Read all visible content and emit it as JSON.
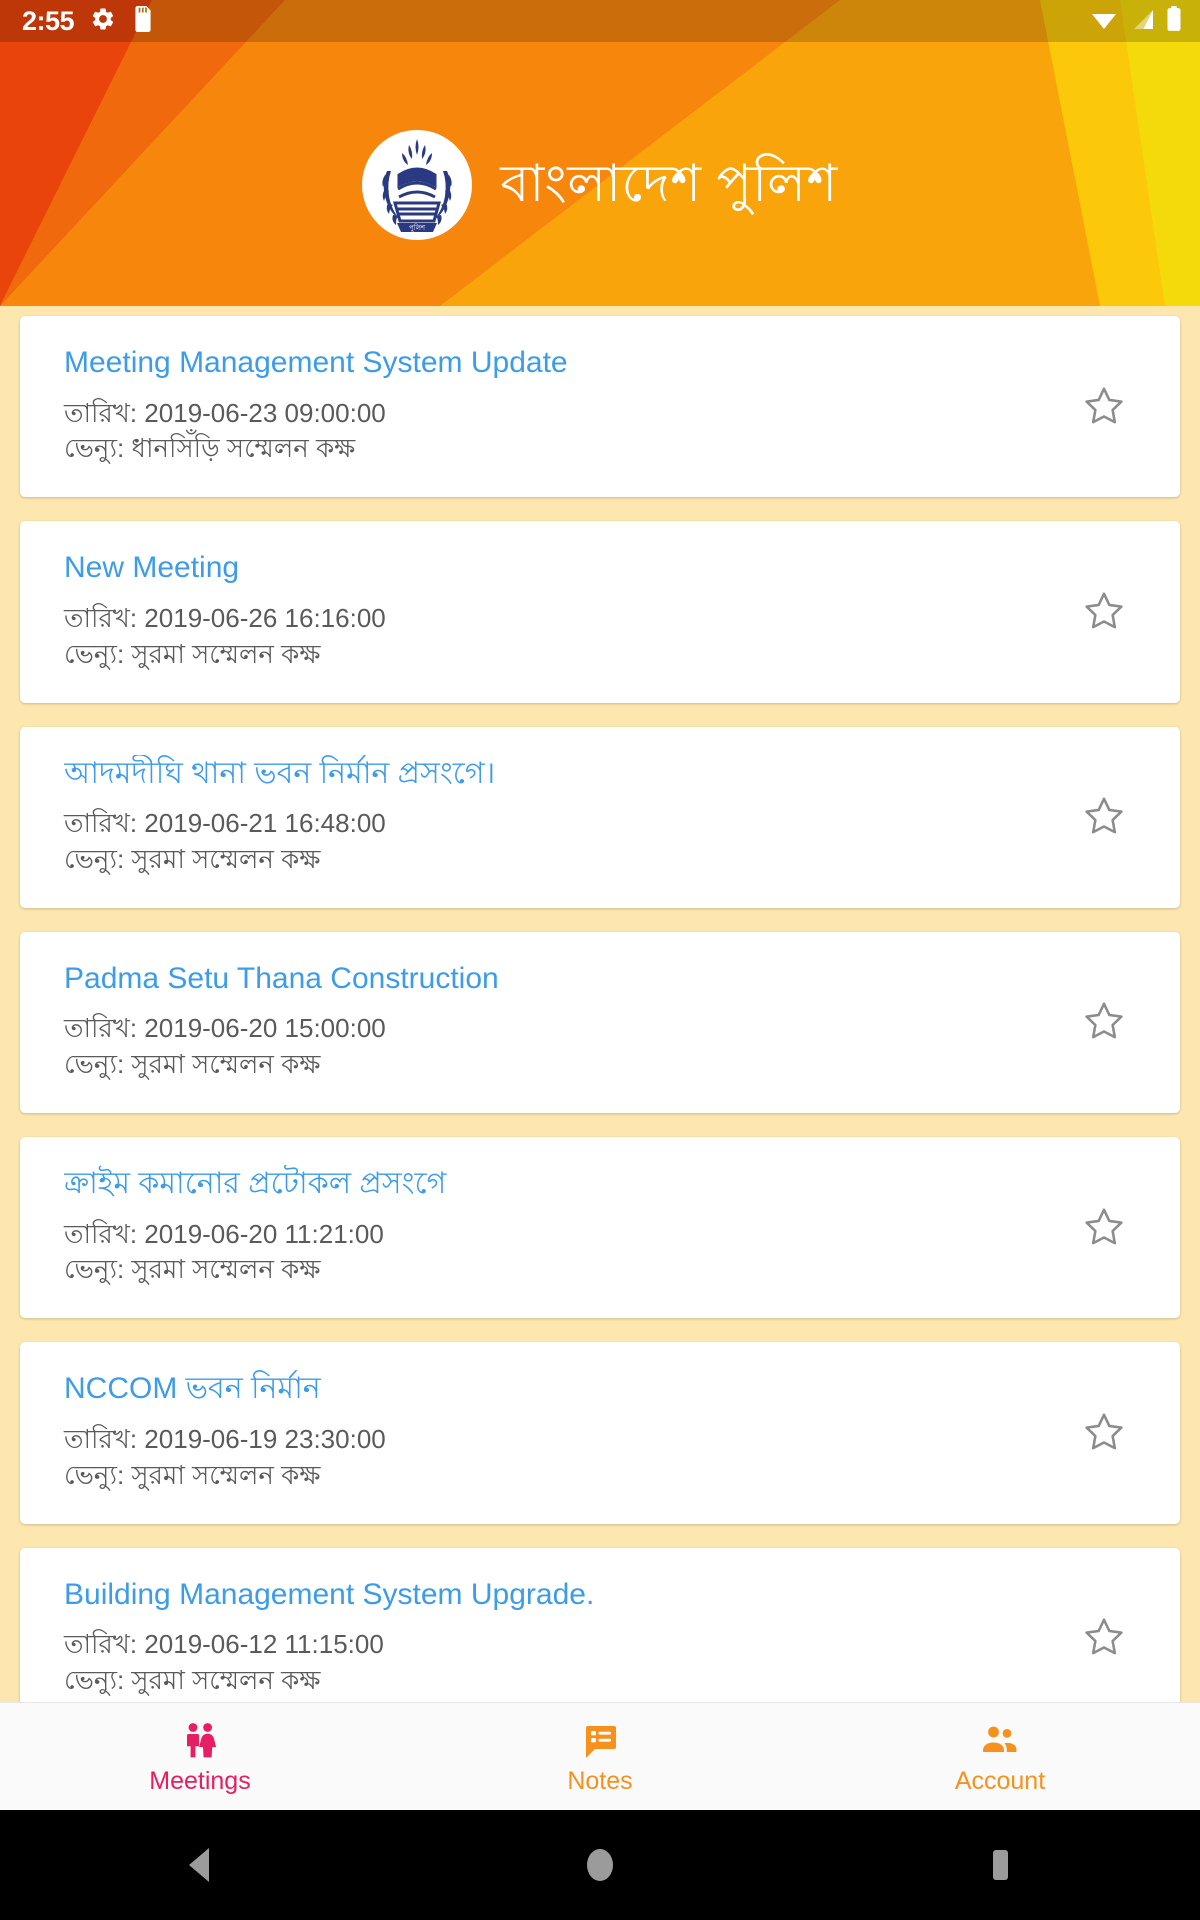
{
  "status_bar": {
    "time": "2:55",
    "icons": [
      "gear-icon",
      "sd-card-icon",
      "wifi-icon",
      "cellular-signal-icon",
      "battery-icon"
    ]
  },
  "header": {
    "title": "বাংলাদেশ পুলিশ",
    "logo_name": "bangladesh-police-emblem",
    "colors": {
      "red": "#E8440C",
      "orange": "#F7860D",
      "orange_light": "#F99A12",
      "amber": "#FBB40A",
      "yellow": "#F5DA0B",
      "status_tint": "#B5700A"
    }
  },
  "theme": {
    "page_background": "#FDE7AF",
    "card_background": "#FFFFFF",
    "title_color": "#3D9CE8",
    "meta_color": "#5A5A5A",
    "star_color": "#8C8C8C",
    "active_nav_color": "#E61E63",
    "inactive_nav_color": "#F5921E"
  },
  "labels": {
    "date_prefix": "তারিখ:",
    "venue_prefix": "ভেন্যু:"
  },
  "meetings": [
    {
      "title": "Meeting Management System Update",
      "date": "তারিখ: 2019-06-23 09:00:00",
      "venue": "ভেন্যু: ধানসিঁড়ি সম্মেলন কক্ষ",
      "starred": false
    },
    {
      "title": "New Meeting",
      "date": "তারিখ: 2019-06-26 16:16:00",
      "venue": "ভেন্যু: সুরমা সম্মেলন কক্ষ",
      "starred": false
    },
    {
      "title": "আদমদীঘি থানা ভবন নির্মান প্রসংগে।",
      "date": "তারিখ: 2019-06-21 16:48:00",
      "venue": "ভেন্যু: সুরমা সম্মেলন কক্ষ",
      "starred": false
    },
    {
      "title": "Padma Setu Thana Construction",
      "date": "তারিখ: 2019-06-20 15:00:00",
      "venue": "ভেন্যু: সুরমা সম্মেলন কক্ষ",
      "starred": false
    },
    {
      "title": "ক্রাইম কমানোর প্রটোকল প্রসংগে",
      "date": "তারিখ: 2019-06-20 11:21:00",
      "venue": "ভেন্যু: সুরমা সম্মেলন কক্ষ",
      "starred": false
    },
    {
      "title": "NCCOM ভবন নির্মান",
      "date": "তারিখ: 2019-06-19 23:30:00",
      "venue": "ভেন্যু: সুরমা সম্মেলন কক্ষ",
      "starred": false
    },
    {
      "title": "Building Management System Upgrade.",
      "date": "তারিখ: 2019-06-12 11:15:00",
      "venue": "ভেন্যু: সুরমা সম্মেলন কক্ষ",
      "starred": false
    }
  ],
  "bottom_nav": {
    "items": [
      {
        "label": "Meetings",
        "icon": "people-couple-icon",
        "active": true
      },
      {
        "label": "Notes",
        "icon": "notes-list-bubble-icon",
        "active": false
      },
      {
        "label": "Account",
        "icon": "people-group-icon",
        "active": false
      }
    ]
  },
  "android_nav": {
    "back": "back-triangle-icon",
    "home": "home-circle-icon",
    "recents": "recents-square-icon"
  }
}
